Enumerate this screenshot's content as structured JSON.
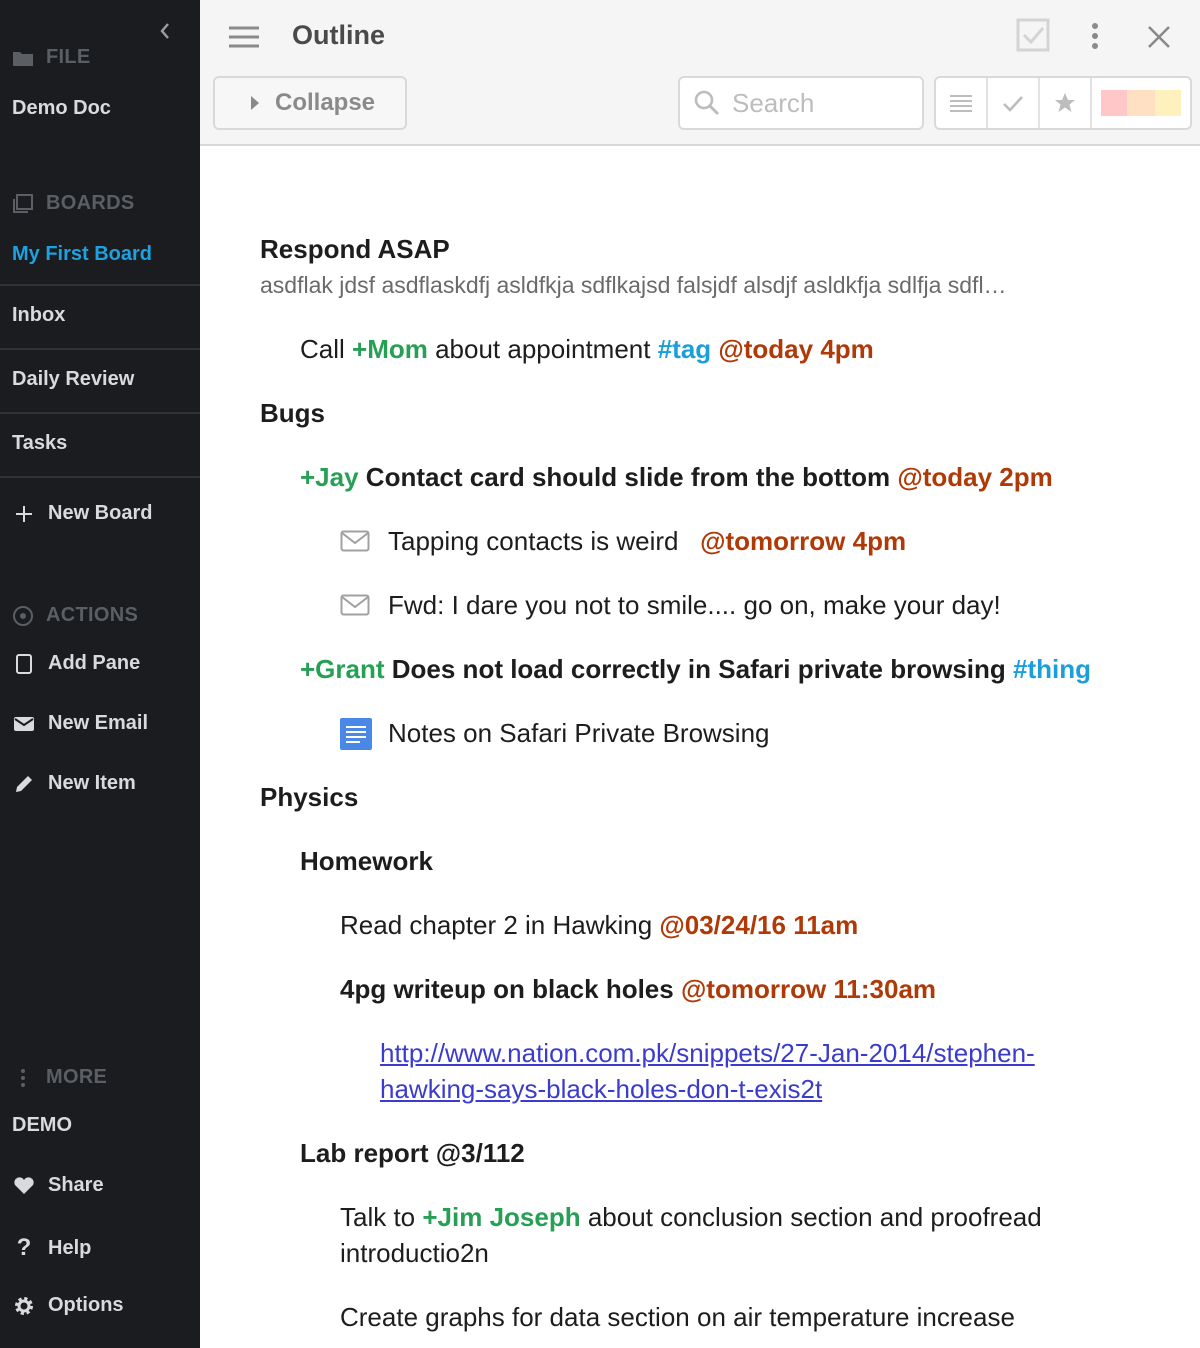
{
  "sidebar": {
    "file_heading": "FILE",
    "doc_name": "Demo Doc",
    "boards_heading": "BOARDS",
    "boards": [
      "My First Board",
      "Inbox",
      "Daily Review",
      "Tasks"
    ],
    "new_board": "New Board",
    "actions_heading": "ACTIONS",
    "actions": [
      "Add Pane",
      "New Email",
      "New Item"
    ],
    "more_heading": "MORE",
    "demo_label": "DEMO",
    "more_items": [
      "Share",
      "Help",
      "Options"
    ]
  },
  "header": {
    "title": "Outline",
    "collapse_label": "Collapse",
    "search_placeholder": "Search"
  },
  "outline": {
    "respond": {
      "title": "Respond ASAP",
      "note": "asdflak jdsf asdflaskdfj asldfkja sdflkajsd falsjdf alsdjf asldkfja sdlfja sdfl…"
    },
    "call": {
      "pre": "Call ",
      "person": "+Mom",
      "mid": " about appointment ",
      "tag": "#tag",
      "date": "@today 4pm"
    },
    "bugs": "Bugs",
    "bug1": {
      "person": "+Jay",
      "text": " Contact card should slide from the bottom ",
      "date": "@today 2pm"
    },
    "email1": {
      "text": "Tapping contacts is weird",
      "date": "@tomorrow 4pm"
    },
    "email2": {
      "text": "Fwd: I dare you not to smile.... go on, make your day!"
    },
    "bug2": {
      "person": "+Grant",
      "text": " Does not load correctly in Safari private browsing ",
      "tag": "#thing"
    },
    "doc1": {
      "text": "Notes on Safari Private Browsing"
    },
    "physics": "Physics",
    "homework": "Homework",
    "read": {
      "text": "Read chapter 2 in Hawking ",
      "date": "@03/24/16 11am"
    },
    "writeup": {
      "text": "4pg writeup on black holes ",
      "date": "@tomorrow 11:30am"
    },
    "link_line1": "http://www.nation.com.pk/snippets/27-Jan-2014/stephen-",
    "link_line2": "hawking-says-black-holes-don-t-exis2t",
    "lab": "Lab report @3/112",
    "talk": {
      "pre": "Talk to ",
      "person": "+Jim Joseph",
      "post": " about conclusion section and proofread",
      "line2": "introductio2n"
    },
    "graphs": "Create graphs for data section on air temperature increase"
  },
  "colors": {
    "accent": "#1ea1e0",
    "person": "#27a055",
    "tag": "#1a9fda",
    "date": "#b03a07",
    "sidebar_bg": "#1a1c1f"
  }
}
